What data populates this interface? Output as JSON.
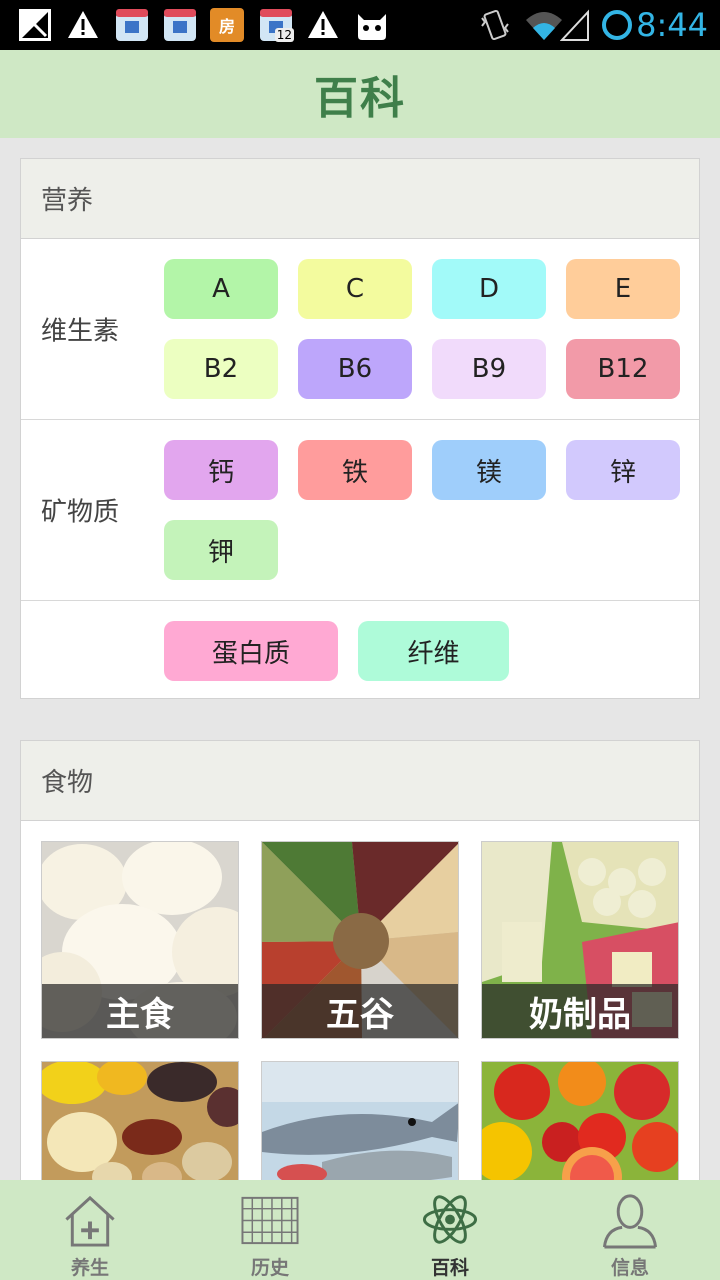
{
  "status_bar": {
    "time": "8:44",
    "notif_badge": "12",
    "notif_fang": "房"
  },
  "header": {
    "title": "百科"
  },
  "nutrition": {
    "title": "营养",
    "vitamins": {
      "label": "维生素",
      "items": [
        {
          "label": "A",
          "color": "#b3f5a8"
        },
        {
          "label": "C",
          "color": "#f3fb9e"
        },
        {
          "label": "D",
          "color": "#a2faf9"
        },
        {
          "label": "E",
          "color": "#ffcd9a"
        },
        {
          "label": "B2",
          "color": "#ecffc1"
        },
        {
          "label": "B6",
          "color": "#bda6fb"
        },
        {
          "label": "B9",
          "color": "#f1dbfb"
        },
        {
          "label": "B12",
          "color": "#f29aa8"
        }
      ]
    },
    "minerals": {
      "label": "矿物质",
      "items": [
        {
          "label": "钙",
          "color": "#e2a6ee"
        },
        {
          "label": "铁",
          "color": "#ff9c9c"
        },
        {
          "label": "镁",
          "color": "#9fcefb"
        },
        {
          "label": "锌",
          "color": "#d2c9fd"
        },
        {
          "label": "钾",
          "color": "#c4f3ba"
        }
      ]
    },
    "others": {
      "items": [
        {
          "label": "蛋白质",
          "color": "#ffa9d3"
        },
        {
          "label": "纤维",
          "color": "#aefbd9"
        }
      ]
    }
  },
  "foods": {
    "title": "食物",
    "items": [
      {
        "label": "主食"
      },
      {
        "label": "五谷"
      },
      {
        "label": "奶制品"
      },
      {
        "label": ""
      },
      {
        "label": ""
      },
      {
        "label": ""
      }
    ]
  },
  "bottom_nav": {
    "items": [
      {
        "label": "养生",
        "icon": "house-plus-icon"
      },
      {
        "label": "历史",
        "icon": "grid-icon"
      },
      {
        "label": "百科",
        "icon": "atom-icon"
      },
      {
        "label": "信息",
        "icon": "person-icon"
      }
    ],
    "active_index": 2
  }
}
